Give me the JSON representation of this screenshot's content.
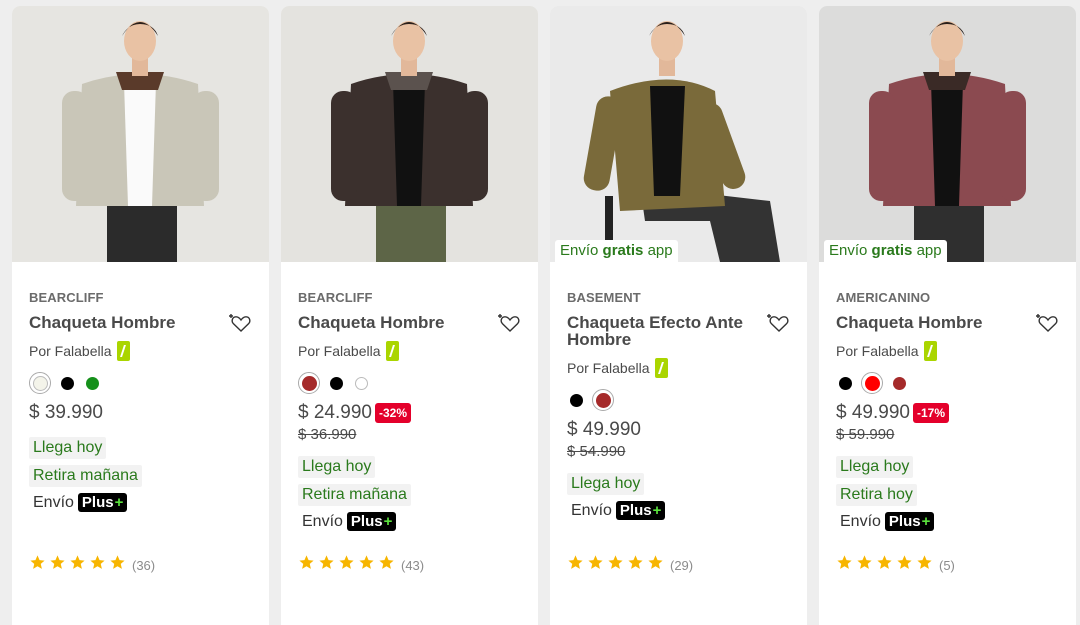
{
  "products": [
    {
      "brand": "BEARCLIFF",
      "title": "Chaqueta Hombre",
      "seller": "Por Falabella",
      "promo": null,
      "swatches": [
        "#f4f4ea",
        "#000000",
        "#15901a"
      ],
      "selected_swatch": 0,
      "price": "$ 39.990",
      "discount": null,
      "old_price": null,
      "tags": [
        "Llega hoy",
        "Retira mañana"
      ],
      "envio": "Envío",
      "plus": "Plus",
      "rating": 5,
      "reviews": "(36)",
      "photo": {
        "bg": "#e6e5e1",
        "jacket": "#c9c6b8",
        "collar": "#5a3a2a",
        "shirt": "#fafafa",
        "pants": "#2b2b2b"
      }
    },
    {
      "brand": "BEARCLIFF",
      "title": "Chaqueta Hombre",
      "seller": "Por Falabella",
      "promo": null,
      "swatches": [
        "#a52a2a",
        "#000000",
        "#ffffff"
      ],
      "selected_swatch": 0,
      "price": "$ 24.990",
      "discount": "-32%",
      "old_price": "$ 36.990",
      "tags": [
        "Llega hoy",
        "Retira mañana"
      ],
      "envio": "Envío",
      "plus": "Plus",
      "rating": 5,
      "reviews": "(43)",
      "photo": {
        "bg": "#e4e3df",
        "jacket": "#3b302d",
        "collar": "#5b524e",
        "shirt": "#111111",
        "pants": "#5d6547"
      }
    },
    {
      "brand": "BASEMENT",
      "title": "Chaqueta Efecto Ante Hombre",
      "seller": "Por Falabella",
      "promo": {
        "text1": "Envío",
        "bold": "gratis",
        "text2": "app"
      },
      "swatches": [
        "#000000",
        "#a52a2a"
      ],
      "selected_swatch": 1,
      "price": "$ 49.990",
      "discount": null,
      "old_price": "$ 54.990",
      "tags": [
        "Llega hoy"
      ],
      "envio": "Envío",
      "plus": "Plus",
      "rating": 5,
      "reviews": "(29)",
      "photo": {
        "bg": "#eaeaea",
        "jacket": "#7a6a3a",
        "collar": "#6d5d31",
        "shirt": "#111111",
        "pants": "#333333"
      }
    },
    {
      "brand": "AMERICANINO",
      "title": "Chaqueta Hombre",
      "seller": "Por Falabella",
      "promo": {
        "text1": "Envío",
        "bold": "gratis",
        "text2": "app"
      },
      "swatches": [
        "#000000",
        "#ff0000",
        "#a52a2a"
      ],
      "selected_swatch": 1,
      "price": "$ 49.990",
      "discount": "-17%",
      "old_price": "$ 59.990",
      "tags": [
        "Llega hoy",
        "Retira hoy"
      ],
      "envio": "Envío",
      "plus": "Plus",
      "rating": 5,
      "reviews": "(5)",
      "photo": {
        "bg": "#dcdcdb",
        "jacket": "#8b4a50",
        "collar": "#3a2a26",
        "shirt": "#111111",
        "pants": "#2f2f2f"
      }
    }
  ],
  "accent": {
    "green_text": "#2a7a1c",
    "discount_red": "#e4002b",
    "star": "#f7b500",
    "falabella_green": "#aad500"
  }
}
